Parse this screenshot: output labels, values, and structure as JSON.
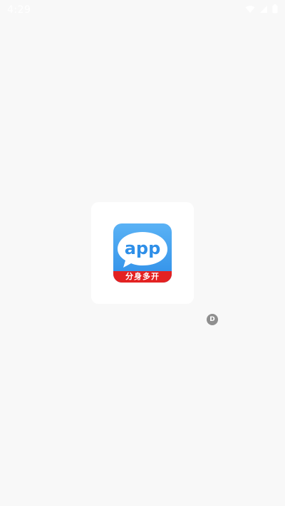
{
  "status_bar": {
    "time": "4:29",
    "icons": [
      "wifi-icon",
      "cell-signal-icon",
      "battery-icon"
    ]
  },
  "splash": {
    "app_icon": {
      "label_main": "app",
      "label_banner": "分身多开",
      "colors": {
        "top_gradient_start": "#5ab2f5",
        "top_gradient_end": "#2f8fe8",
        "bubble": "#ffffff",
        "text": "#2f8fe8",
        "banner": "#e32222"
      }
    }
  },
  "debug_badge": {
    "label": "D",
    "color": "#8f8f8f"
  },
  "background_color": "#f8f8f8"
}
